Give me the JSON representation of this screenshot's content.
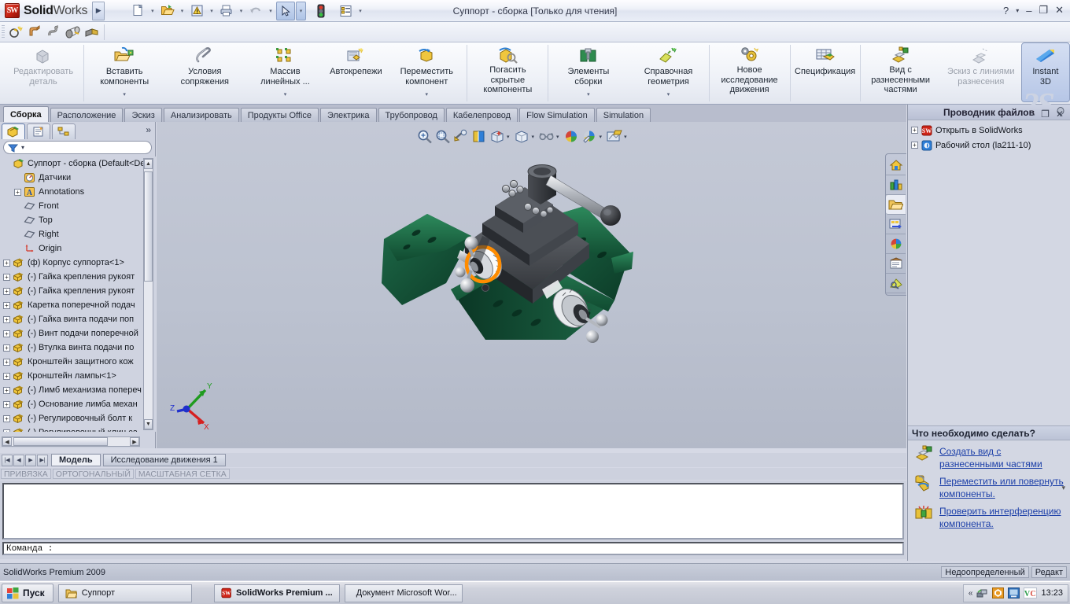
{
  "titlebar": {
    "brand_prefix": "Solid",
    "brand_suffix": "Works",
    "cube_text": "SW",
    "document_title": "Суппорт - сборка [Только для чтения]",
    "help_icon": "?",
    "help_caret": "▾",
    "minimize_icon": "–",
    "restore_icon": "❐",
    "close_icon": "✕",
    "tools": [
      {
        "name": "new-document",
        "glyph": "page"
      },
      {
        "name": "open-document",
        "glyph": "folder"
      },
      {
        "name": "rebuild",
        "glyph": "warn"
      },
      {
        "name": "print",
        "glyph": "printer"
      },
      {
        "name": "undo",
        "glyph": "undo"
      },
      {
        "name": "select",
        "glyph": "cursor"
      },
      {
        "name": "sensor-status",
        "glyph": "traffic"
      },
      {
        "name": "options",
        "glyph": "list"
      }
    ]
  },
  "strip2": {
    "tools": [
      {
        "name": "wizard-hole-icon"
      },
      {
        "name": "extrude-icon"
      },
      {
        "name": "sweep-icon"
      },
      {
        "name": "loft-icon"
      },
      {
        "name": "rib-icon"
      }
    ]
  },
  "ribbon": {
    "watermark": "2S",
    "items": [
      {
        "label": "Редактировать деталь",
        "icon": "edit-part-icon",
        "dimmed": true,
        "dropdown": false,
        "active": false
      },
      {
        "label": "Вставить компоненты",
        "icon": "insert-components-icon",
        "dimmed": false,
        "dropdown": true,
        "active": false
      },
      {
        "label": "Условия сопряжения",
        "icon": "mate-icon",
        "dimmed": false,
        "dropdown": false,
        "active": false
      },
      {
        "label": "Массив линейных ...",
        "icon": "linear-pattern-icon",
        "dimmed": false,
        "dropdown": true,
        "active": false
      },
      {
        "label": "Автокрепежи",
        "icon": "smart-fasteners-icon",
        "dimmed": false,
        "dropdown": false,
        "active": false
      },
      {
        "label": "Переместить компонент",
        "icon": "move-component-icon",
        "dimmed": false,
        "dropdown": true,
        "active": false
      },
      {
        "label": "Погасить скрытые компоненты",
        "icon": "suppress-hidden-icon",
        "dimmed": false,
        "dropdown": false,
        "active": false
      },
      {
        "label": "Элементы сборки",
        "icon": "assembly-features-icon",
        "dimmed": false,
        "dropdown": true,
        "active": false
      },
      {
        "label": "Справочная геометрия",
        "icon": "reference-geometry-icon",
        "dimmed": false,
        "dropdown": true,
        "active": false
      },
      {
        "label": "Новое исследование движения",
        "icon": "new-motion-study-icon",
        "dimmed": false,
        "dropdown": false,
        "active": false
      },
      {
        "label": "Спецификация",
        "icon": "bill-of-materials-icon",
        "dimmed": false,
        "dropdown": false,
        "active": false
      },
      {
        "label": "Вид с разнесенными частями",
        "icon": "exploded-view-icon",
        "dimmed": false,
        "dropdown": false,
        "active": false
      },
      {
        "label": "Эскиз с линиями разнесения",
        "icon": "explode-line-sketch-icon",
        "dimmed": true,
        "dropdown": false,
        "active": false
      },
      {
        "label": "Instant 3D",
        "icon": "instant3d-icon",
        "dimmed": false,
        "dropdown": false,
        "active": true
      }
    ]
  },
  "doc_tabs": {
    "items": [
      "Сборка",
      "Расположение",
      "Эскиз",
      "Анализировать",
      "Продукты Office",
      "Электрика",
      "Трубопровод",
      "Кабелепровод",
      "Flow Simulation",
      "Simulation"
    ],
    "selected_index": 0,
    "minimize_icon": "–",
    "restore_icon": "❐",
    "close_icon": "✕"
  },
  "left_panel": {
    "tabs": [
      {
        "name": "feature-manager-tab",
        "selected": true
      },
      {
        "name": "property-manager-tab",
        "selected": false
      },
      {
        "name": "configuration-manager-tab",
        "selected": false
      }
    ],
    "more_icon": "»",
    "filter_placeholder": "",
    "filter_caret": "▾",
    "tree": [
      {
        "label": "Суппорт - сборка  (Default<Def",
        "icon": "assembly-icon",
        "plus": false,
        "indent": 0
      },
      {
        "label": "Датчики",
        "icon": "sensors-icon",
        "plus": false,
        "indent": 1
      },
      {
        "label": "Annotations",
        "icon": "annotations-icon",
        "plus": true,
        "indent": 1
      },
      {
        "label": "Front",
        "icon": "plane-icon",
        "plus": false,
        "indent": 1
      },
      {
        "label": "Top",
        "icon": "plane-icon",
        "plus": false,
        "indent": 1
      },
      {
        "label": "Right",
        "icon": "plane-icon",
        "plus": false,
        "indent": 1
      },
      {
        "label": "Origin",
        "icon": "origin-icon",
        "plus": false,
        "indent": 1
      },
      {
        "label": "(ф) Корпус суппорта<1>",
        "icon": "component-icon",
        "plus": true,
        "indent": 0
      },
      {
        "label": "(-) Гайка крепления рукоят",
        "icon": "component-icon",
        "plus": true,
        "indent": 0
      },
      {
        "label": "(-) Гайка крепления рукоят",
        "icon": "component-icon",
        "plus": true,
        "indent": 0
      },
      {
        "label": "Каретка поперечной подач",
        "icon": "component-icon",
        "plus": true,
        "indent": 0
      },
      {
        "label": "(-) Гайка винта подачи поп",
        "icon": "component-icon",
        "plus": true,
        "indent": 0
      },
      {
        "label": "(-) Винт подачи поперечной",
        "icon": "component-icon",
        "plus": true,
        "indent": 0
      },
      {
        "label": "(-) Втулка винта подачи по",
        "icon": "component-icon",
        "plus": true,
        "indent": 0
      },
      {
        "label": "Кронштейн защитного кож",
        "icon": "component-icon",
        "plus": true,
        "indent": 0
      },
      {
        "label": "Кронштейн лампы<1>",
        "icon": "component-icon",
        "plus": true,
        "indent": 0
      },
      {
        "label": "(-) Лимб механизма попереч",
        "icon": "component-icon",
        "plus": true,
        "indent": 0
      },
      {
        "label": "(-) Основание лимба механ",
        "icon": "component-icon",
        "plus": true,
        "indent": 0
      },
      {
        "label": "(-) Регулировочный болт к",
        "icon": "component-icon",
        "plus": true,
        "indent": 0
      },
      {
        "label": "(-) Регулировочный клин са",
        "icon": "component-icon",
        "plus": true,
        "indent": 0
      }
    ]
  },
  "graphics": {
    "view_tools": [
      {
        "name": "zoom-to-fit-icon",
        "caret": false
      },
      {
        "name": "zoom-to-area-icon",
        "caret": false
      },
      {
        "name": "previous-view-icon",
        "caret": false
      },
      {
        "name": "section-view-icon",
        "caret": false
      },
      {
        "name": "view-orientation-icon",
        "caret": true
      },
      {
        "name": "display-style-icon",
        "caret": true
      },
      {
        "name": "hide-show-items-icon",
        "caret": true
      },
      {
        "name": "edit-appearance-icon",
        "caret": false
      },
      {
        "name": "apply-scene-icon",
        "caret": true
      },
      {
        "name": "view-settings-icon",
        "caret": true
      }
    ],
    "triad": {
      "x_label": "X",
      "y_label": "Y",
      "z_label": "Z",
      "x_color": "#d62020",
      "y_color": "#1f9b1f",
      "z_color": "#2030cc"
    },
    "task_icons": [
      {
        "name": "sw-resources-icon",
        "selected": false
      },
      {
        "name": "design-library-icon",
        "selected": false
      },
      {
        "name": "file-explorer-icon",
        "selected": true
      },
      {
        "name": "search-icon",
        "selected": false
      },
      {
        "name": "view-palette-icon",
        "selected": false
      },
      {
        "name": "appearances-scenes-icon",
        "selected": false
      },
      {
        "name": "custom-properties-icon",
        "selected": false
      },
      {
        "name": "document-recovery-icon",
        "selected": false
      }
    ]
  },
  "right_panel": {
    "header": "Проводник файлов",
    "pin_icon": "pin",
    "tree": [
      {
        "label": "Открыть в SolidWorks",
        "icon": "solidworks-icon"
      },
      {
        "label": "Рабочий стол (la211-10)",
        "icon": "desktop-icon"
      }
    ],
    "section2_header": "Что необходимо сделать?",
    "tasks": [
      {
        "text": "Создать вид с разнесенными частями",
        "icon": "exploded-view-icon"
      },
      {
        "text": "Переместить или повернуть компоненты.",
        "icon": "move-component-icon"
      },
      {
        "text": "Проверить интерференцию компонента.",
        "icon": "interference-detection-icon"
      }
    ]
  },
  "bottom": {
    "nav_buttons": [
      "|◀",
      "◀",
      "▶",
      "▶|"
    ],
    "model_tabs": [
      {
        "label": "Модель",
        "selected": true
      },
      {
        "label": "Исследование движения 1",
        "selected": false
      }
    ],
    "status_pills": [
      "ПРИВЯЗКА",
      "ОРТОГОНАЛЬНЫЙ",
      "МАСШТАБНАЯ СЕТКА"
    ],
    "command_label": "Команда :",
    "command_value": "",
    "command_caret": "▾"
  },
  "statusbar": {
    "product": "SolidWorks Premium 2009",
    "right_items": [
      "Недоопределенный",
      "Редакт"
    ]
  },
  "taskbar": {
    "start_label": "Пуск",
    "tasks": [
      {
        "label": "Суппорт",
        "icon": "folder-icon",
        "active": false
      },
      {
        "label": "SolidWorks Premium ...",
        "icon": "solidworks-icon",
        "active": true
      },
      {
        "label": "Документ Microsoft Wor...",
        "icon": "word-icon",
        "active": false
      }
    ],
    "tray_expand": "«",
    "tray_icons": [
      "network-icon",
      "shield-icon",
      "display-icon",
      "vnc-icon"
    ],
    "clock": "13:23"
  }
}
